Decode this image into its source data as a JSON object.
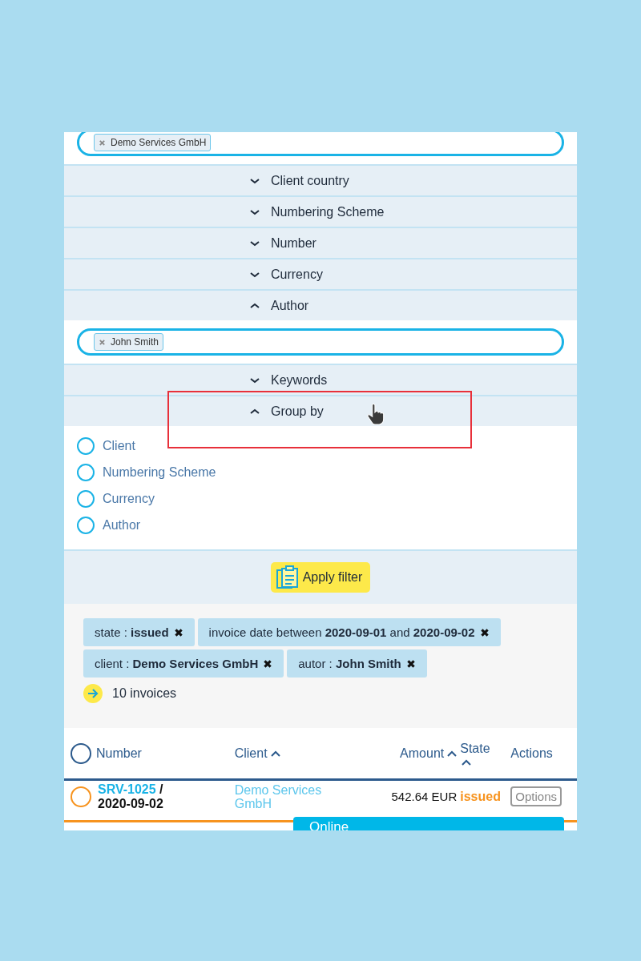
{
  "top_field": {
    "chips": [
      "Demo Services GmbH"
    ]
  },
  "sections": [
    {
      "label": "Client country",
      "expanded": false
    },
    {
      "label": "Numbering Scheme",
      "expanded": false
    },
    {
      "label": "Number",
      "expanded": false
    },
    {
      "label": "Currency",
      "expanded": false
    },
    {
      "label": "Author",
      "expanded": true,
      "kind": "chips",
      "chips": [
        "John Smith"
      ]
    },
    {
      "label": "Keywords",
      "expanded": false
    },
    {
      "label": "Group by",
      "expanded": true,
      "kind": "radios",
      "options": [
        {
          "label": "Client",
          "selected": false
        },
        {
          "label": "Numbering Scheme",
          "selected": false
        },
        {
          "label": "Currency",
          "selected": false
        },
        {
          "label": "Author",
          "selected": false
        }
      ]
    }
  ],
  "apply_button": "Apply filter",
  "active_filters": [
    "state : **issued**",
    "invoice date between **2020-09-01** and **2020-09-02**",
    "client : **Demo Services GmbH**",
    "autor : **John Smith**"
  ],
  "result_count": "10 invoices",
  "table": {
    "select_all": false,
    "columns": [
      {
        "label": "Number",
        "sortable": false
      },
      {
        "label": "Client",
        "sortable": true
      },
      {
        "label": "Amount",
        "sortable": true
      },
      {
        "label": "State",
        "sortable": true
      },
      {
        "label": "Actions",
        "sortable": false
      }
    ],
    "rows": [
      {
        "selected": false,
        "number": "SRV-1025",
        "separator": "/",
        "date": "2020-09-02",
        "client": "Demo Services GmbH",
        "amount": "542.64 EUR",
        "state": "issued",
        "action": "Options"
      }
    ]
  },
  "chat_bar": {
    "label": "Online"
  }
}
